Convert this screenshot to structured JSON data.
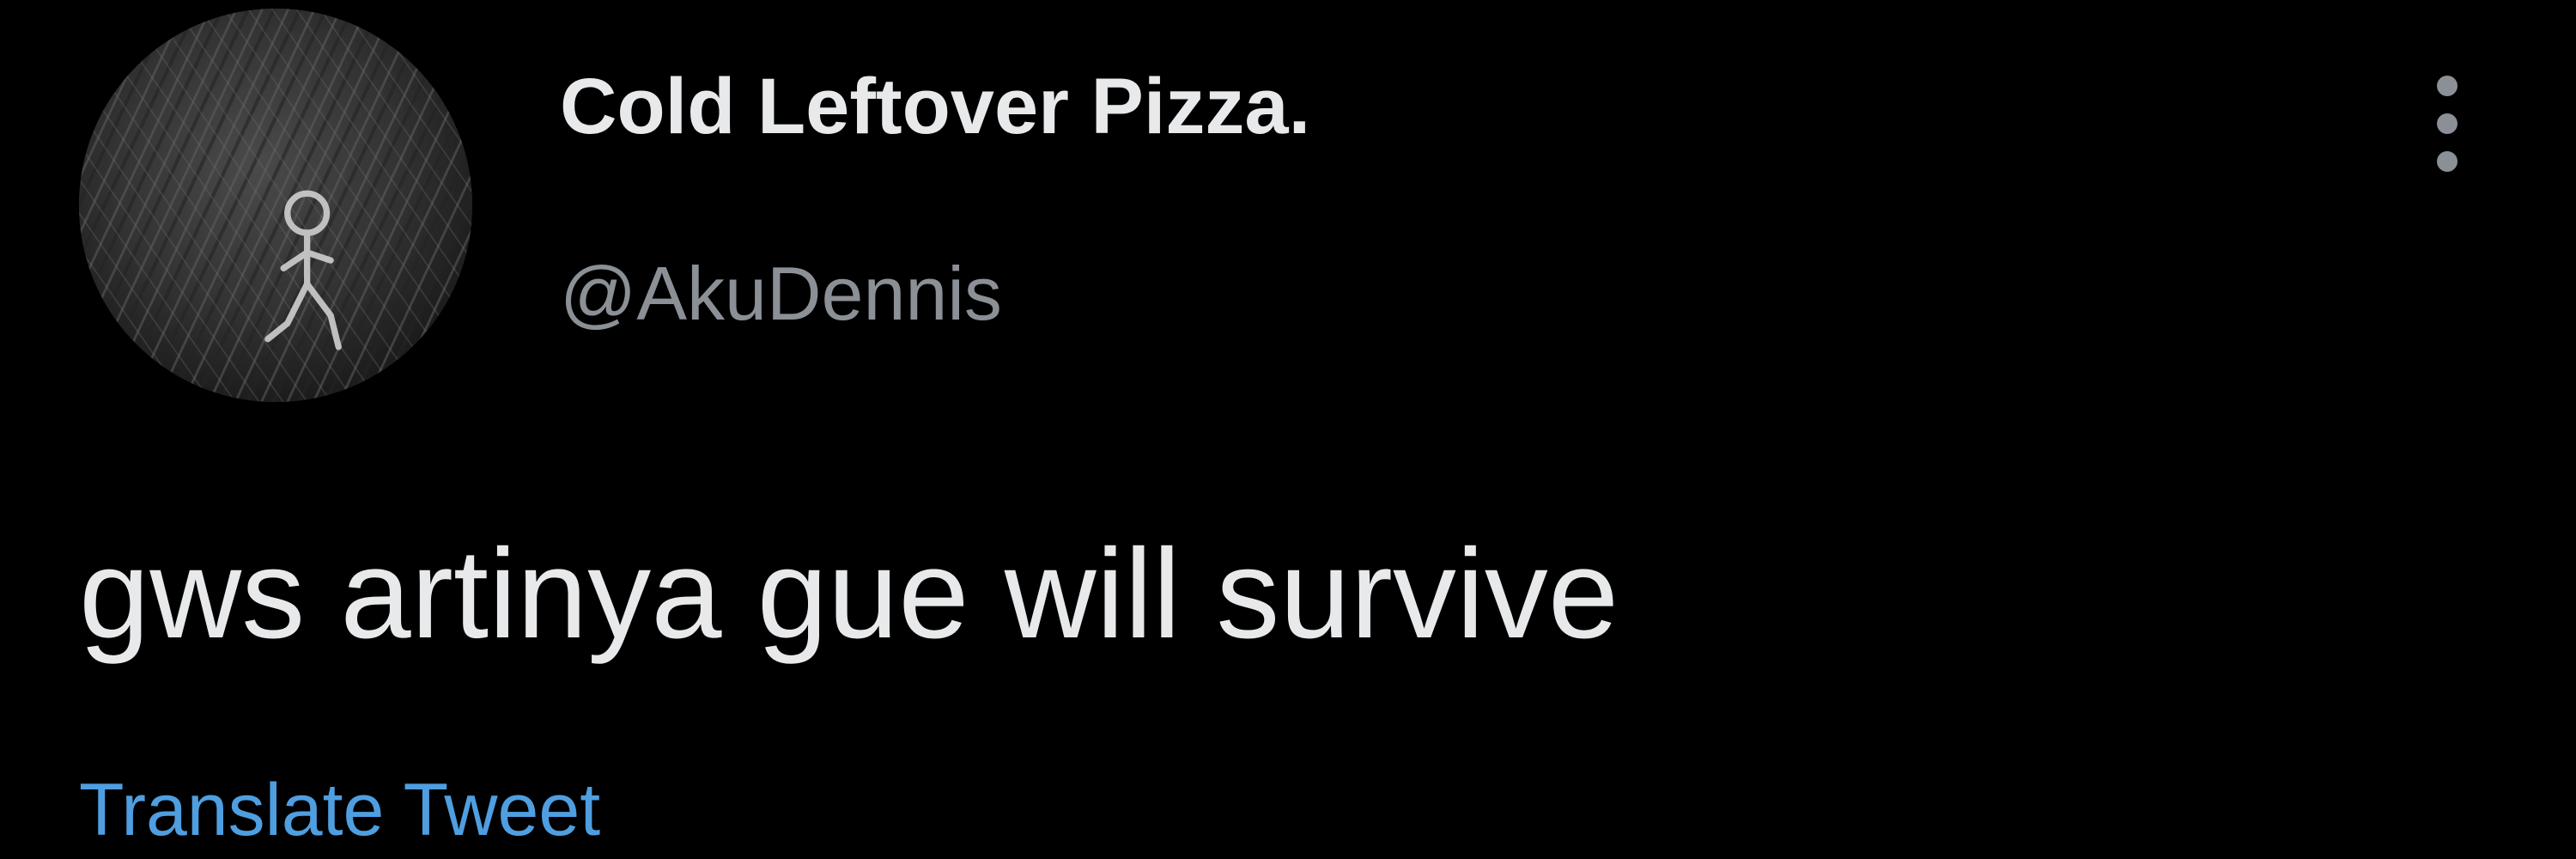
{
  "tweet": {
    "author": {
      "display_name": "Cold Leftover Pizza.",
      "handle": "@AkuDennis",
      "avatar_icon": "sketched-figure-avatar"
    },
    "text": "gws artinya gue will survive",
    "translate_label": "Translate Tweet",
    "more_icon": "more-vertical-icon"
  },
  "colors": {
    "background": "#000000",
    "primary_text": "#e7e9ea",
    "secondary_text": "#8b9096",
    "link": "#4f9ee0"
  }
}
